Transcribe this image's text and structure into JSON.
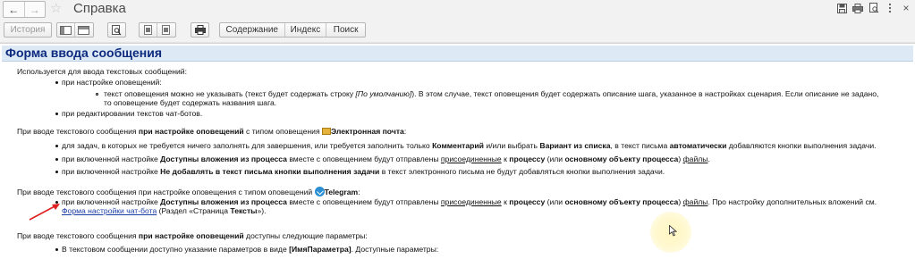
{
  "window": {
    "title": "Справка",
    "close_glyph": "×"
  },
  "toolbar": {
    "history_label": "История",
    "contents_label": "Содержание",
    "index_label": "Индекс",
    "search_label": "Поиск"
  },
  "page": {
    "heading": "Форма ввода сообщения",
    "intro": "Используется для ввода текстовых сообщений:",
    "item1": "при настройке оповещений:",
    "item1_sub_a": "текст оповещения можно не указывать (текст будет содержать строку ",
    "item1_sub_default": "[По умолчанию]",
    "item1_sub_b": "). В этом случае, текст оповещения будет содержать описание шага, указанное в настройках сценария. Если описание не задано,",
    "item1_sub_c": "то оповещение будет содержать названия шага.",
    "item2": "при редактировании текстов чат-ботов.",
    "email_intro_a": "При вводе текстового сообщения ",
    "email_intro_b": "при настройке оповещений",
    "email_intro_c": " с типом оповещения ",
    "email_type": "Электронная почта",
    "email_intro_d": ":",
    "e1_a": "для задач, в которых не требуется ничего заполнять для завершения, или требуется заполнить только ",
    "e1_b": "Комментарий",
    "e1_c": " и/или выбрать ",
    "e1_d": "Вариант из списка",
    "e1_e": ", в текст письма ",
    "e1_f": "автоматически",
    "e1_g": " добавляются кнопки выполнения задачи.",
    "e2_a": "при включенной настройке ",
    "e2_b": "Доступны вложения из процесса",
    "e2_c": " вместе с оповещением будут отправлены ",
    "e2_d": "присоединенные",
    "e2_e": " к ",
    "e2_f": "процессу",
    "e2_g": " (или ",
    "e2_h": "основному объекту процесса",
    "e2_i": ") ",
    "e2_j": "файлы",
    "e2_k": ".",
    "e3_a": "при включенной настройке ",
    "e3_b": "Не добавлять в текст письма кнопки выполнения задачи",
    "e3_c": " в текст электронного письма не будут добавляться кнопки выполнения задачи.",
    "tg_intro_a": "При вводе текстового сообщения при настройке оповещения с типом оповещений ",
    "tg_type": "Telegram",
    "tg_intro_b": ":",
    "t1_a": "при включенной настройке ",
    "t1_b": "Доступны вложения из процесса",
    "t1_c": " вместе с оповещением будут отправлены ",
    "t1_d": "присоединенные",
    "t1_e": " к ",
    "t1_f": "процессу",
    "t1_g": " (или ",
    "t1_h": "основному объекту процесса",
    "t1_i": ") ",
    "t1_j": "файлы",
    "t1_k": ". Про настройку дополнительных вложений см.",
    "t1_link": "Форма настройки чат-бота",
    "t1_l": " (Раздел «Страница ",
    "t1_m": "Тексты",
    "t1_n": "»).",
    "params_a": "При вводе текстового сообщения ",
    "params_b": "при настройке оповещений",
    "params_c": " доступны следующие параметры:",
    "p1_a": "В текстовом сообщении доступно указание параметров в виде ",
    "p1_b": "[ИмяПараметра]",
    "p1_c": ". Доступные параметры:"
  },
  "colors": {
    "heading_text": "#0d2a7e",
    "heading_bg": "#ddeaf6",
    "link": "#1a3ea6",
    "annotation_arrow": "#e02020"
  }
}
